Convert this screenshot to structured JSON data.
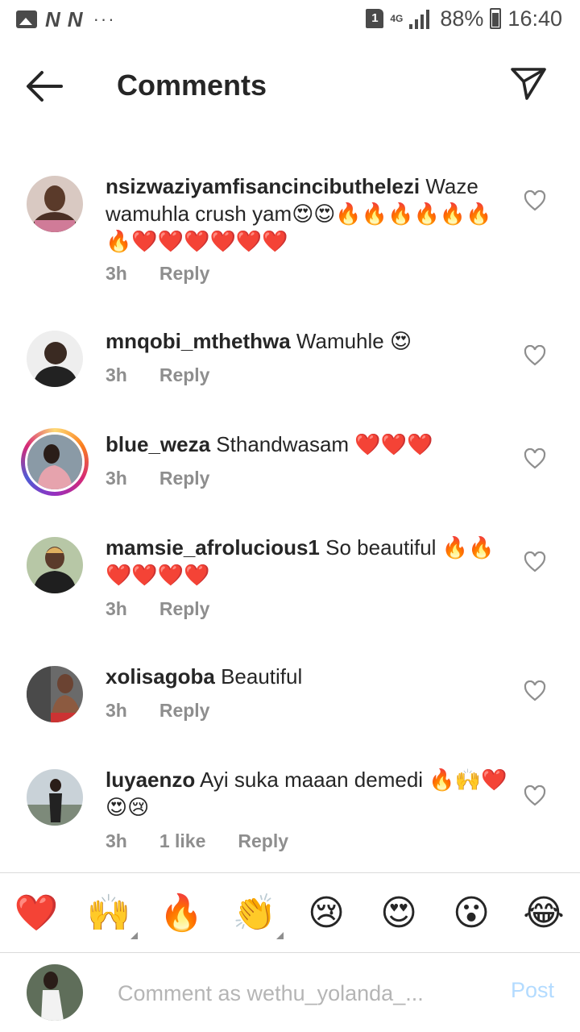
{
  "status_bar": {
    "network": "4G",
    "sim": "1",
    "battery": "88%",
    "time": "16:40",
    "left_icons": [
      "image-icon",
      "n-icon",
      "n-icon",
      "more-dots-icon"
    ]
  },
  "header": {
    "title": "Comments",
    "back_icon": "arrow-left-icon",
    "share_icon": "paper-plane-icon"
  },
  "comments": [
    {
      "username": "nsizwaziyamfisancincibuthelezi",
      "text": "Waze wamuhla crush yam😍😍🔥🔥🔥🔥🔥🔥🔥❤️❤️❤️❤️❤️❤️",
      "time": "3h",
      "likes": "",
      "reply": "Reply"
    },
    {
      "username": "mnqobi_mthethwa",
      "text": "Wamuhle 😍",
      "time": "3h",
      "likes": "",
      "reply": "Reply"
    },
    {
      "username": "blue_weza",
      "text": "Sthandwasam ❤️❤️❤️",
      "time": "3h",
      "likes": "",
      "reply": "Reply"
    },
    {
      "username": "mamsie_afrolucious1",
      "text": "So beautiful 🔥🔥❤️❤️❤️❤️",
      "time": "3h",
      "likes": "",
      "reply": "Reply"
    },
    {
      "username": "xolisagoba",
      "text": "Beautiful",
      "time": "3h",
      "likes": "",
      "reply": "Reply"
    },
    {
      "username": "luyaenzo",
      "text": "Ayi suka maaan demedi 🔥🙌❤️😍😢",
      "time": "3h",
      "likes": "1 like",
      "reply": "Reply"
    }
  ],
  "emoji_bar": [
    "❤️",
    "🙌",
    "🔥",
    "👏",
    "😢",
    "😍",
    "😮",
    "😂"
  ],
  "composer": {
    "placeholder": "Comment as wethu_yolanda_...",
    "post_label": "Post"
  },
  "colors": {
    "text": "#262626",
    "meta": "#8e8e8e",
    "post_disabled": "#b3dbff",
    "divider": "#dbdbdb"
  }
}
